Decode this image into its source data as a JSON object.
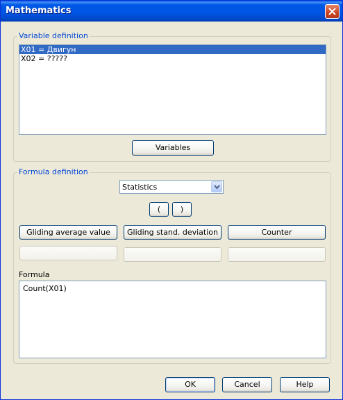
{
  "window": {
    "title": "Mathematics",
    "close_icon": "close-icon"
  },
  "variable_definition": {
    "label": "Variable definition",
    "items": [
      "X01 = Двигун",
      "X02 = ?????"
    ],
    "selected_index": 0,
    "variables_button": "Variables"
  },
  "formula_definition": {
    "label": "Formula definition",
    "category": {
      "value": "Statistics",
      "icon": "chevron-down-icon"
    },
    "paren_open": "(",
    "paren_close": ")",
    "function_buttons": [
      "Gliding average value",
      "Gliding stand. deviation",
      "Counter"
    ],
    "empty_buttons": [
      "",
      "",
      ""
    ],
    "formula_label": "Formula",
    "formula_value": "Count(X01)"
  },
  "footer": {
    "ok": "OK",
    "cancel": "Cancel",
    "help": "Help"
  },
  "colors": {
    "titlebar": "#0054e3",
    "selection": "#316ac5",
    "group_label": "#0046d5",
    "dialog_bg": "#ece9d8"
  }
}
